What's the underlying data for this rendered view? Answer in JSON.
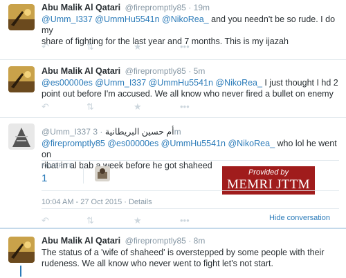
{
  "tweets": [
    {
      "name": "Abu Malik Al Qatari",
      "handle": "@firepromptly85",
      "time": "· 19m",
      "line1_mentions": "@Umm_I337 @UmmHu5541n @NikoRea_",
      "line1_text": " and you needn't be so rude. I do my",
      "line2": "share of fighting for the last year and 7 months. This is my ijazah"
    },
    {
      "name": "Abu Malik Al Qatari",
      "handle": "@firepromptly85",
      "time": "· 5m",
      "line1_mentions": "@es00000es @Umm_I337 @UmmHu5541n @NikoRea_",
      "line1_text": " I just thought I hd 2",
      "line2": "point out before I'm accused. We all know who never fired a bullet on enemy"
    },
    {
      "handle": "@Umm_I337",
      "name_arabic": "أم حسين البريطانية",
      "time": "· 3m",
      "line1_mentions": "@firepromptly85 @es00000es @UmmHu5541n @NikoRea_",
      "line1_text": " who lol he went on",
      "line2": "ribat in al bab a week before he got shaheed",
      "favorite_label": "FAVORITE",
      "favorite_count": "1",
      "date_line": "10:04 AM - 27 Oct 2015 · Details",
      "hide_conversation": "Hide conversation"
    },
    {
      "name": "Abu Malik Al Qatari",
      "handle": "@firepromptly85",
      "time": "· 8m",
      "line1": "The status of a 'wife of shaheed' is overstepped by some people with their",
      "line2": "rudeness. We all know who never went to fight let's not start."
    }
  ],
  "actions": {
    "reply_icon": "reply-icon",
    "retweet_icon": "retweet-icon",
    "favorite_icon": "star-icon",
    "more_icon": "more-icon"
  },
  "badge": {
    "top": "Provided by",
    "bottom": "MEMRI JTTM"
  },
  "colors": {
    "link": "#2b7bb9",
    "muted": "#8899a6",
    "badge": "#a01c1c"
  }
}
